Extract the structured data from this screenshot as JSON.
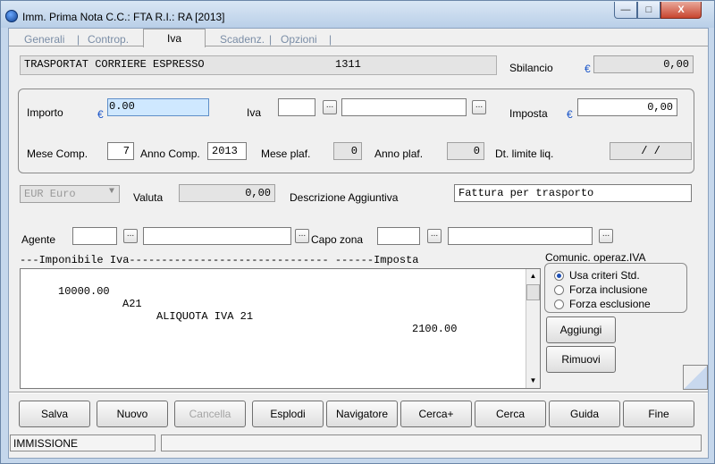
{
  "window": {
    "title": "Imm. Prima Nota C.C.: FTA  R.I.: RA  [2013]",
    "min_glyph": "—",
    "max_glyph": "□",
    "close_glyph": "X"
  },
  "tabs": [
    {
      "label": "Generali"
    },
    {
      "label": "Controp."
    },
    {
      "label": "Iva"
    },
    {
      "label": "Scadenz."
    },
    {
      "label": "Opzioni"
    }
  ],
  "tab_sep": "|",
  "header": {
    "description": "TRASPORTAT CORRIERE ESPRESSO",
    "code": "1311",
    "sbilancio_label": "Sbilancio",
    "sbilancio_value": "0,00"
  },
  "currency_symbol": "€",
  "dots_glyph": "...",
  "iva_box": {
    "importo_label": "Importo",
    "importo_value": "0.00",
    "iva_label": "Iva",
    "iva_code": "",
    "iva_desc": "",
    "imposta_label": "Imposta",
    "imposta_value": "0,00",
    "mese_comp_label": "Mese Comp.",
    "mese_comp_value": "7",
    "anno_comp_label": "Anno Comp.",
    "anno_comp_value": "2013",
    "mese_plaf_label": "Mese plaf.",
    "mese_plaf_value": "0",
    "anno_plaf_label": "Anno plaf.",
    "anno_plaf_value": "0",
    "dt_limite_label": "Dt. limite liq.",
    "dt_limite_value": "/  /"
  },
  "valuta": {
    "select_value": "EUR Euro",
    "label": "Valuta",
    "amount": "0,00"
  },
  "descrizione": {
    "label": "Descrizione Aggiuntiva",
    "value": "Fattura per trasporto"
  },
  "agente": {
    "label": "Agente",
    "code": "",
    "desc": ""
  },
  "capozona": {
    "label": "Capo zona",
    "code": "",
    "desc": ""
  },
  "table": {
    "header": "---Imponibile Iva------------------------------- ------Imposta",
    "rows": [
      {
        "imponibile": "10000.00",
        "codice": "A21",
        "descrizione": "ALIQUOTA IVA 21",
        "imposta": "2100.00"
      }
    ]
  },
  "comunic": {
    "title": "Comunic. operaz.IVA",
    "options": [
      {
        "label": "Usa criteri Std.",
        "checked": true
      },
      {
        "label": "Forza inclusione",
        "checked": false
      },
      {
        "label": "Forza esclusione",
        "checked": false
      }
    ]
  },
  "side_buttons": {
    "aggiungi": "Aggiungi",
    "rimuovi": "Rimuovi"
  },
  "bottom_buttons": [
    "Salva",
    "Nuovo",
    "Cancella",
    "Esplodi",
    "Navigatore",
    "Cerca+",
    "Cerca",
    "Guida",
    "Fine"
  ],
  "status": {
    "mode": "IMMISSIONE",
    "message": ""
  }
}
